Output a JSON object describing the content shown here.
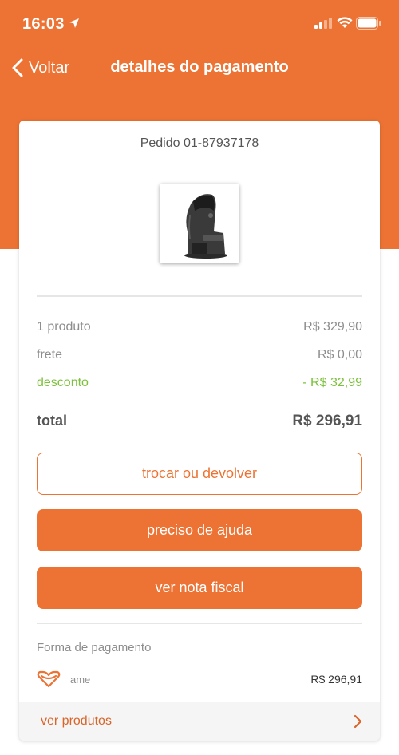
{
  "status_bar": {
    "time": "16:03"
  },
  "nav": {
    "back_label": "Voltar",
    "title": "detalhes do pagamento"
  },
  "order": {
    "id_label": "Pedido 01-87937178"
  },
  "summary": {
    "products_label": "1 produto",
    "products_value": "R$ 329,90",
    "shipping_label": "frete",
    "shipping_value": "R$ 0,00",
    "discount_label": "desconto",
    "discount_value": "- R$ 32,99",
    "total_label": "total",
    "total_value": "R$ 296,91"
  },
  "actions": {
    "exchange_label": "trocar ou devolver",
    "help_label": "preciso de ajuda",
    "invoice_label": "ver nota fiscal"
  },
  "payment": {
    "section_label": "Forma de pagamento",
    "method_label": "ame",
    "amount": "R$ 296,91"
  },
  "footer": {
    "label": "ver produtos"
  },
  "colors": {
    "brand": "#ec7334",
    "discount": "#7cc13d"
  },
  "icons": [
    "location-arrow-icon",
    "signal-icon",
    "wifi-icon",
    "battery-icon",
    "chevron-left-icon",
    "coffee-machine-image",
    "ame-heart-icon",
    "chevron-right-icon"
  ]
}
